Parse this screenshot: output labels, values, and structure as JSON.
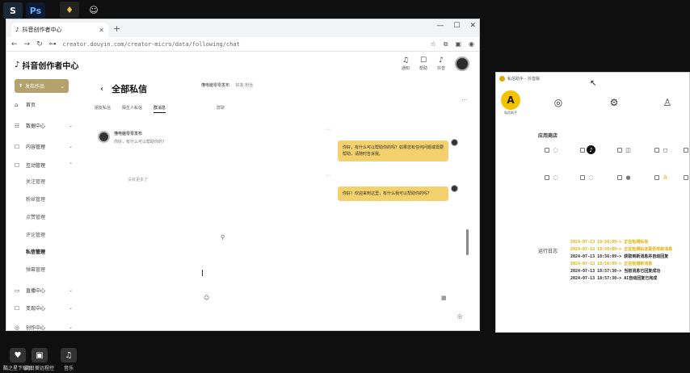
{
  "desktop": {
    "icons": [
      {
        "name": "steam",
        "glyph": "S"
      },
      {
        "name": "photoshop",
        "glyph": "Ps"
      },
      {
        "name": "app3",
        "glyph": "♦"
      },
      {
        "name": "app4",
        "glyph": "☺"
      }
    ],
    "taskbar": [
      {
        "label": "酷之星下载助",
        "glyph": "♥"
      },
      {
        "label": "向日葵远程控",
        "glyph": "▣"
      },
      {
        "label": "音乐",
        "glyph": "♫"
      }
    ]
  },
  "browser": {
    "tab_title": "抖音创作者中心",
    "url": "creator.douyin.com/creator-micro/data/following/chat",
    "window_controls": [
      "—",
      "☐",
      "✕"
    ]
  },
  "creator": {
    "logo": "抖音创作者中心",
    "header_buttons": [
      "通知",
      "帮助",
      "抖音"
    ],
    "publish_label": "发布作品",
    "nav": [
      {
        "label": "首页",
        "icon": "⌂",
        "sub": false
      },
      {
        "label": "数据中心",
        "icon": "☷",
        "sub": false,
        "chev": "⌄"
      },
      {
        "label": "内容管理",
        "icon": "☐",
        "sub": false,
        "chev": "⌄"
      },
      {
        "label": "互动管理",
        "icon": "☐",
        "sub": false,
        "chev": "⌃"
      },
      {
        "label": "关注管理",
        "sub": true
      },
      {
        "label": "粉丝管理",
        "sub": true
      },
      {
        "label": "点赞管理",
        "sub": true
      },
      {
        "label": "评论管理",
        "sub": true
      },
      {
        "label": "私信管理",
        "sub": true,
        "selected": true
      },
      {
        "label": "弹幕管理",
        "sub": true
      },
      {
        "label": "直播中心",
        "icon": "▭",
        "sub": false,
        "chev": "⌄"
      },
      {
        "label": "变现中心",
        "icon": "☐",
        "sub": false,
        "chev": "⌄"
      },
      {
        "label": "创作中心",
        "icon": "◎",
        "sub": false,
        "chev": "⌄"
      }
    ],
    "page_title": "全部私信",
    "subtabs": [
      "朋友私信",
      "陌生人私信",
      "群消息"
    ],
    "conversation": {
      "name": "懂电脑零零发布",
      "preview": "你好，有什么可以帮助你的？"
    },
    "no_more": "没有更多了",
    "chat_header": {
      "name": "懂电脑零零发布",
      "sub": "好友 粉丝"
    },
    "chat_label": "群聊",
    "more_icon": "···",
    "messages": [
      {
        "text": "你好，有什么可以帮助你的吗？如果您有任何问题或需要帮助，请随时告诉我。"
      },
      {
        "text": "你好！欢迎来到这里，有什么我可以帮助你的吗？"
      }
    ]
  },
  "panel": {
    "title": "私信助手 - 抖音版",
    "nav": [
      {
        "label": "私信助手",
        "glyph": "A"
      },
      {
        "label": "",
        "glyph": "◎"
      },
      {
        "label": "",
        "glyph": "⚙"
      },
      {
        "label": "",
        "glyph": "♙"
      }
    ],
    "app_store_title": "应用商店",
    "apps_row1": [
      "◌",
      "♪",
      "◫",
      "◻",
      "▣"
    ],
    "apps_row2": [
      "◌",
      "◌",
      "●",
      "A",
      "◌"
    ],
    "log_title": "运行日志",
    "logs": [
      {
        "text": "2024-07-13 18:56:09-> 正在检测私信",
        "hl": true
      },
      {
        "text": "2024-07-13 18:56:09-> 正在检测私信是否有新消息",
        "hl": true
      },
      {
        "text": "2024-07-13 18:56:09-> 获取到新消息并自动回复",
        "hl": false
      },
      {
        "text": "2024-07-13 18:56:09-> 正在检测新消息",
        "hl": true
      },
      {
        "text": "2024-07-13 18:57:30-> 当前消息已回复成功",
        "hl": false
      },
      {
        "text": "2024-07-13 18:57:30-> AI自动回复已完成",
        "hl": false
      }
    ]
  }
}
